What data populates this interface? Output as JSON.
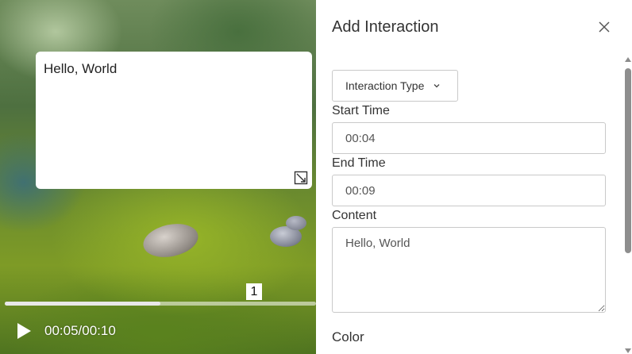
{
  "video": {
    "overlay_text": "Hello, World",
    "marker_label": "1",
    "time": "00:05/00:10",
    "progress": 0.5
  },
  "panel": {
    "title": "Add Interaction",
    "interaction_type_label": "Interaction Type",
    "start_time_label": "Start Time",
    "start_time_value": "00:04",
    "end_time_label": "End Time",
    "end_time_value": "00:09",
    "content_label": "Content",
    "content_value": "Hello, World",
    "color_label": "Color"
  },
  "icons": {
    "close": "close-icon",
    "chevron": "chevron-down-icon",
    "play": "play-icon",
    "resize": "resize-icon"
  }
}
